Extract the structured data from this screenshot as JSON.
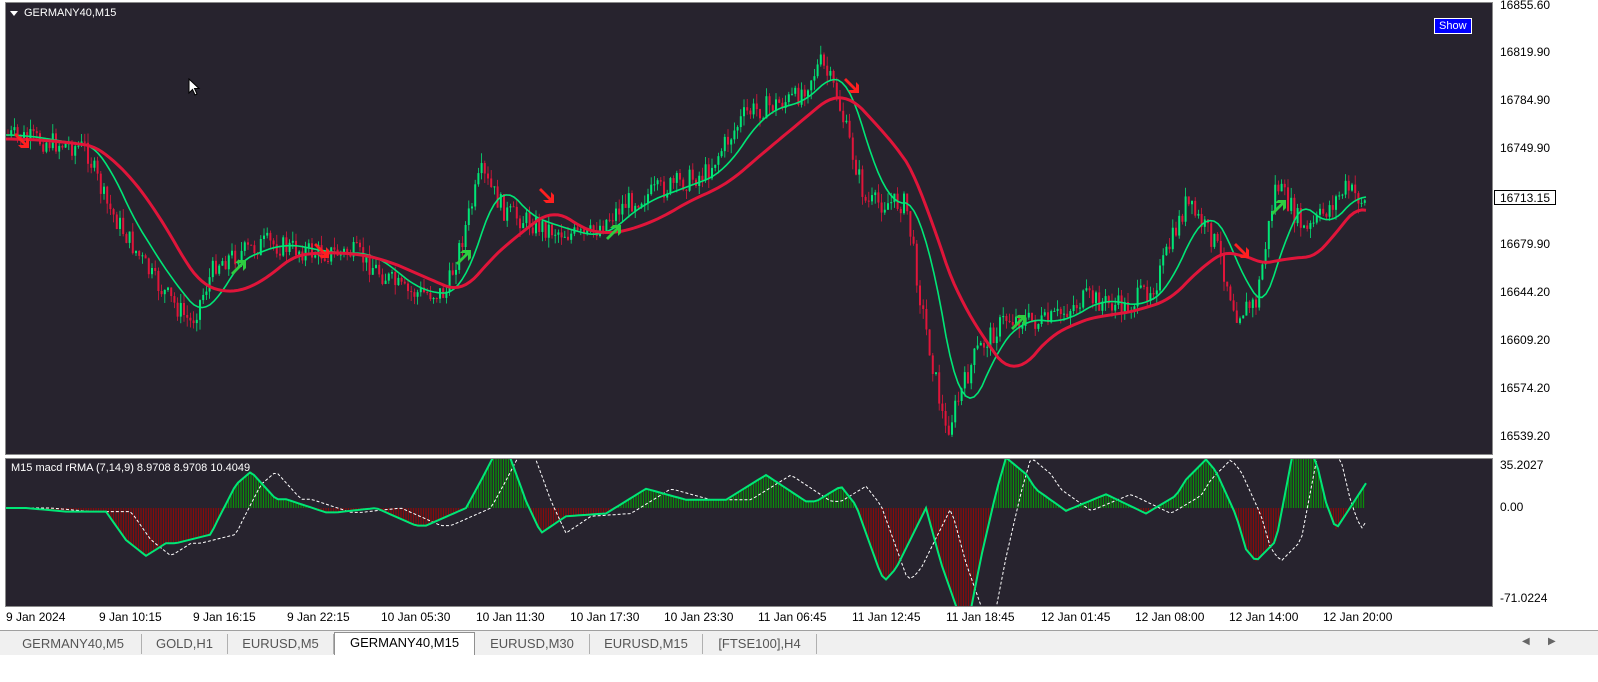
{
  "window": {
    "symbol_title": "GERMANY40,M15",
    "show_button": "Show",
    "current_price": "16713.15"
  },
  "price_axis": [
    "16855.60",
    "16819.90",
    "16784.90",
    "16749.90",
    "16679.90",
    "16644.20",
    "16609.20",
    "16574.20",
    "16539.20"
  ],
  "macd": {
    "title": "M15  macd rRMA (7,14,9)  8.9708 8.9708 10.4049",
    "axis": [
      "35.2027",
      "0.00",
      "-71.0224"
    ]
  },
  "time_axis": [
    "9 Jan 2024",
    "9 Jan 10:15",
    "9 Jan 16:15",
    "9 Jan 22:15",
    "10 Jan 05:30",
    "10 Jan 11:30",
    "10 Jan 17:30",
    "10 Jan 23:30",
    "11 Jan 06:45",
    "11 Jan 12:45",
    "11 Jan 18:45",
    "12 Jan 01:45",
    "12 Jan 08:00",
    "12 Jan 14:00",
    "12 Jan 20:00"
  ],
  "tabs": [
    {
      "label": "GERMANY40,M5",
      "active": false
    },
    {
      "label": "GOLD,H1",
      "active": false
    },
    {
      "label": "EURUSD,M5",
      "active": false
    },
    {
      "label": "GERMANY40,M15",
      "active": true
    },
    {
      "label": "EURUSD,M30",
      "active": false
    },
    {
      "label": "EURUSD,M15",
      "active": false
    },
    {
      "label": "[FTSE100],H4",
      "active": false
    }
  ],
  "icons": {
    "scroll_left": "◀",
    "scroll_right": "▶"
  },
  "colors": {
    "background": "#27232e",
    "bull": "#00e676",
    "bear": "#e0153a",
    "hist_up": "#0a8f0a",
    "hist_down": "#8b0a0a",
    "signal": "#ffffff"
  }
}
